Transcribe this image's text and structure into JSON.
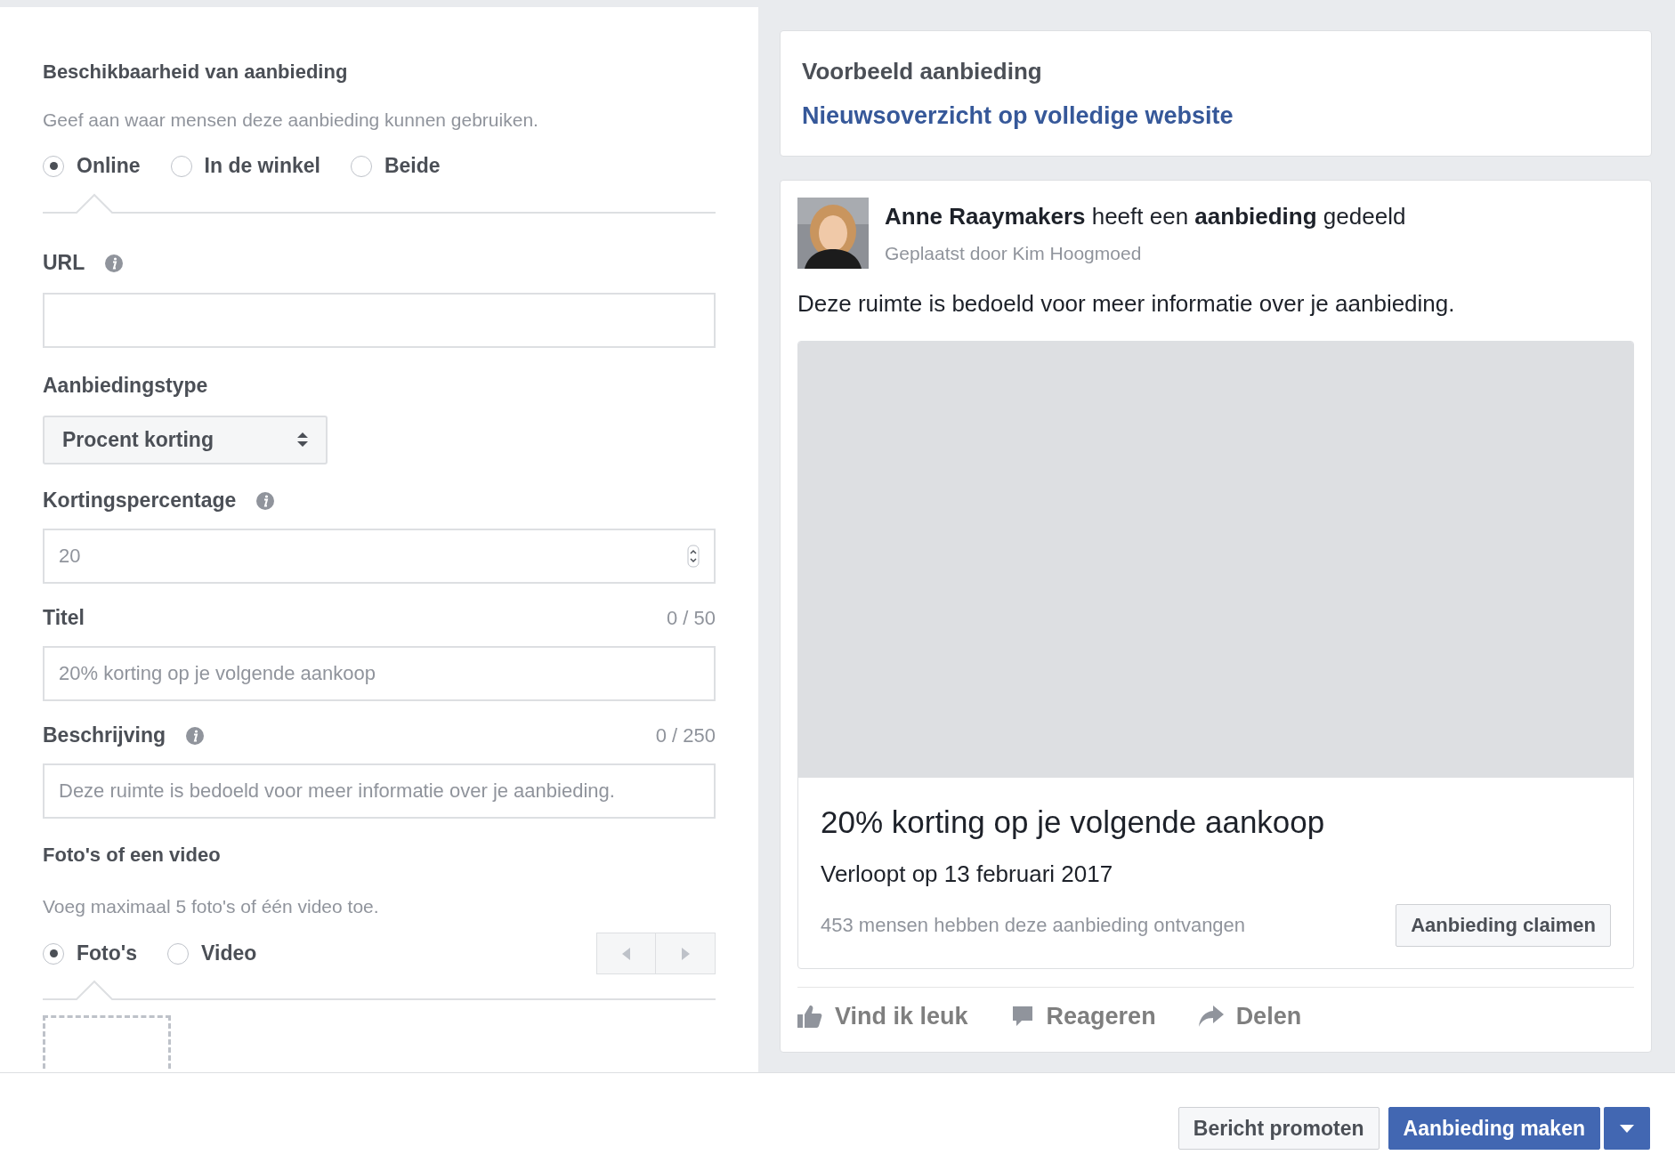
{
  "form": {
    "availability": {
      "heading": "Beschikbaarheid van aanbieding",
      "hint": "Geef aan waar mensen deze aanbieding kunnen gebruiken.",
      "options": [
        {
          "label": "Online",
          "selected": true
        },
        {
          "label": "In de winkel",
          "selected": false
        },
        {
          "label": "Beide",
          "selected": false
        }
      ]
    },
    "url": {
      "label": "URL"
    },
    "offer_type": {
      "label": "Aanbiedingstype",
      "value": "Procent korting"
    },
    "discount": {
      "label": "Kortingspercentage",
      "value": "20"
    },
    "title": {
      "label": "Titel",
      "counter": "0 / 50",
      "placeholder": "20% korting op je volgende aankoop"
    },
    "description": {
      "label": "Beschrijving",
      "counter": "0 / 250",
      "placeholder": "Deze ruimte is bedoeld voor meer informatie over je aanbieding."
    },
    "media": {
      "heading": "Foto's of een video",
      "hint": "Voeg maximaal 5 foto's of één video toe.",
      "options": [
        {
          "label": "Foto's",
          "selected": true
        },
        {
          "label": "Video",
          "selected": false
        }
      ]
    }
  },
  "preview": {
    "heading": "Voorbeeld aanbieding",
    "placement": "Nieuwsoverzicht op volledige website",
    "post": {
      "headline": "**Anne Raaymakers** heeft een **aanbieding** gedeeld",
      "posted_by": "Geplaatst door Kim Hoogmoed",
      "body": "Deze ruimte is bedoeld voor meer informatie over je aanbieding.",
      "offer_title": "20% korting op je volgende aankoop",
      "expiry": "Verloopt op 13 februari 2017",
      "received": "453 mensen hebben deze aanbieding ontvangen",
      "claim_button": "Aanbieding claimen",
      "actions": [
        {
          "kind": "like",
          "label": "Vind ik leuk"
        },
        {
          "kind": "comment",
          "label": "Reageren"
        },
        {
          "kind": "share",
          "label": "Delen"
        }
      ]
    }
  },
  "footer": {
    "buttons": [
      {
        "kind": "secondary",
        "label": "Bericht promoten"
      },
      {
        "kind": "primary",
        "label": "Aanbieding maken"
      }
    ]
  }
}
